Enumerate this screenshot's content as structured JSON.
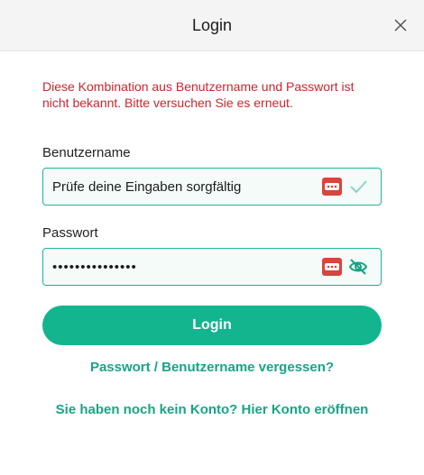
{
  "dialog": {
    "title": "Login",
    "close_icon": "close-icon"
  },
  "error": {
    "message": "Diese Kombination aus Benutzername und Passwort ist nicht bekannt. Bitte versuchen Sie es erneut."
  },
  "username": {
    "label": "Benutzername",
    "value": "Prüfe deine Eingaben sorgfältig",
    "password_manager_icon": "password-manager-icon",
    "status_icon": "checkmark-icon"
  },
  "password": {
    "label": "Passwort",
    "value": "•••••••••••••••",
    "password_manager_icon": "password-manager-icon",
    "toggle_icon": "eye-slash-icon"
  },
  "actions": {
    "login_label": "Login",
    "forgot_label": "Passwort / Benutzername vergessen?",
    "register_label": "Sie haben noch kein Konto? Hier Konto eröffnen"
  },
  "colors": {
    "accent": "#13b58f",
    "error": "#d0242e",
    "link": "#17a585"
  }
}
